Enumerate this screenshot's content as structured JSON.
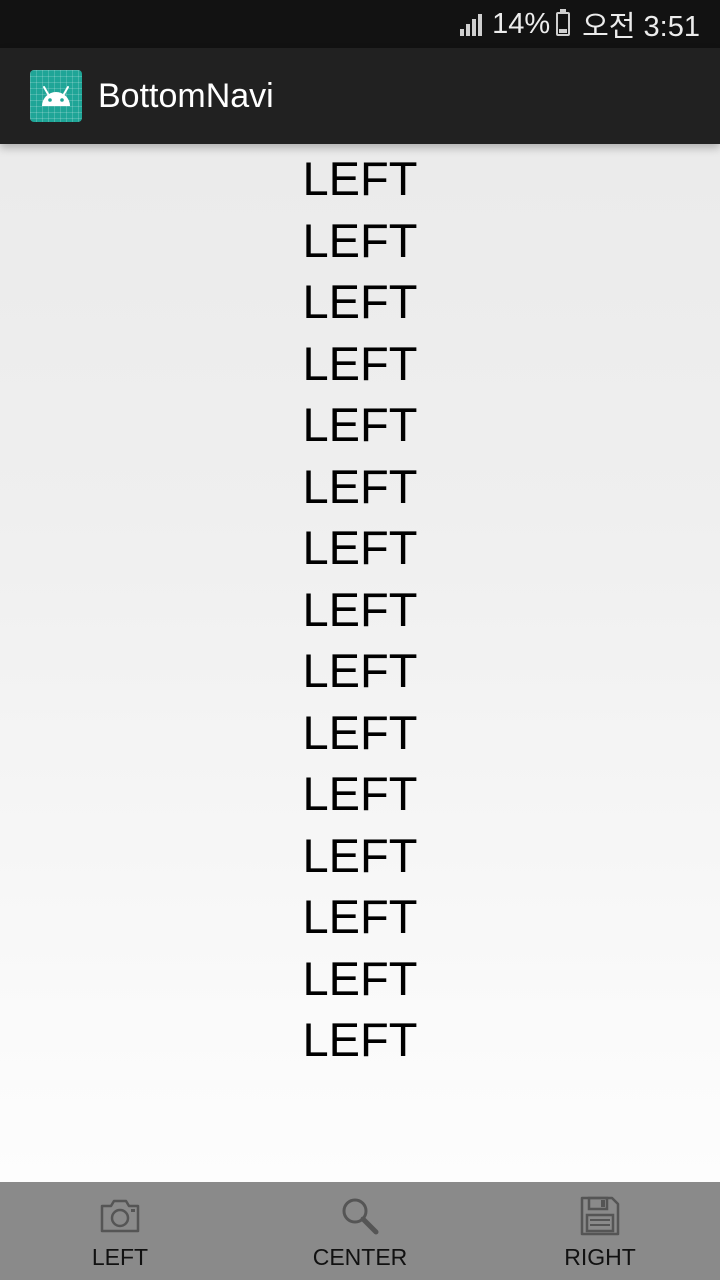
{
  "status_bar": {
    "battery": "14%",
    "time": "오전 3:51"
  },
  "app_bar": {
    "title": "BottomNavi",
    "icon": "android-icon"
  },
  "content": {
    "items": [
      "LEFT",
      "LEFT",
      "LEFT",
      "LEFT",
      "LEFT",
      "LEFT",
      "LEFT",
      "LEFT",
      "LEFT",
      "LEFT",
      "LEFT",
      "LEFT",
      "LEFT",
      "LEFT",
      "LEFT"
    ]
  },
  "bottom_nav": {
    "items": [
      {
        "label": "LEFT",
        "icon": "camera-icon"
      },
      {
        "label": "CENTER",
        "icon": "search-icon"
      },
      {
        "label": "RIGHT",
        "icon": "save-icon"
      }
    ]
  },
  "colors": {
    "status_bar_bg": "#121212",
    "app_bar_bg": "#212121",
    "app_icon_bg": "#1fa597",
    "bottom_nav_bg": "#8a8a8a"
  }
}
